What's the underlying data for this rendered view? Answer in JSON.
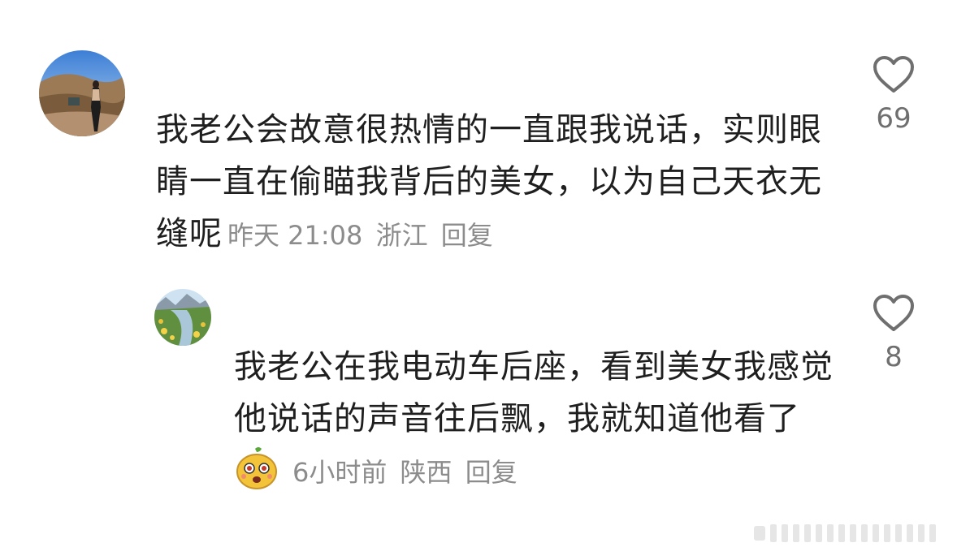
{
  "comments": [
    {
      "avatar": "profile-photo-mountain",
      "text": "我老公会故意很热情的一直跟我说话，实则眼睛一直在偷瞄我背后的美女，以为自己天衣无缝呢",
      "time": "昨天 21:08",
      "location": "浙江",
      "reply_label": "回复",
      "likes": "69",
      "like_icon": "heart-outline-icon"
    }
  ],
  "replies": [
    {
      "avatar": "profile-photo-meadow",
      "text": "我老公在我电动车后座，看到美女我感觉他说话的声音往后飘，我就知道他看了",
      "sticker": "surprised-face-sticker",
      "time": "6小时前",
      "location": "陕西",
      "reply_label": "回复",
      "likes": "8",
      "like_icon": "heart-outline-icon"
    }
  ],
  "colors": {
    "text": "#1f1f1f",
    "meta": "#8c8c8c",
    "icon": "#6f6f6f"
  }
}
